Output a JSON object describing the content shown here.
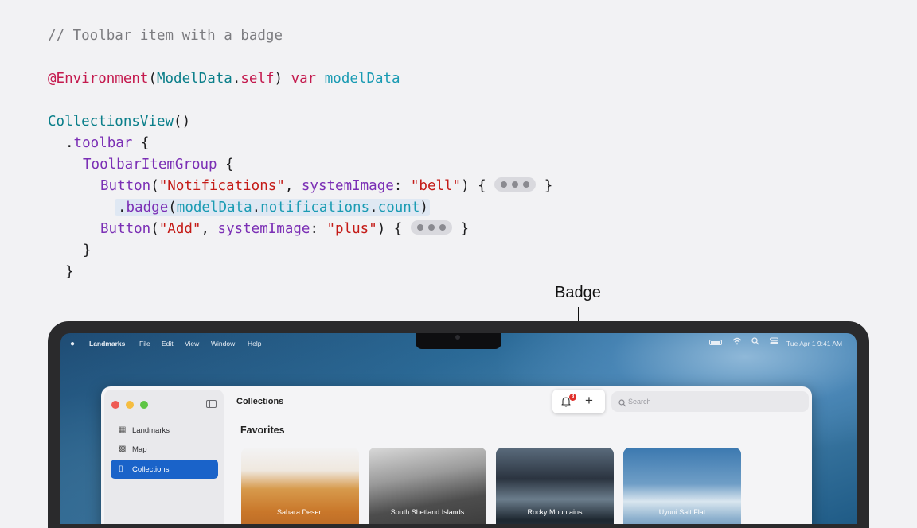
{
  "code": {
    "comment": "// Toolbar item with a badge",
    "env_at": "@Environment",
    "env_paren_open": "(",
    "env_type": "ModelData",
    "env_dot": ".",
    "env_self": "self",
    "env_paren_close": ")",
    "env_var": "var",
    "env_name": "modelData",
    "collections": "CollectionsView",
    "collections_parens": "()",
    "toolbar_dot": ".",
    "toolbar": "toolbar",
    "brace_open": " {",
    "group": "ToolbarItemGroup",
    "button": "Button",
    "paren_open": "(",
    "notif_str": "\"Notifications\"",
    "comma": ", ",
    "system_image": "systemImage",
    "colon": ": ",
    "bell_str": "\"bell\"",
    "close_brace_open": ") {",
    "close_brace": "}",
    "badge_dot": ".",
    "badge": "badge",
    "model_data": "modelData",
    "dot": ".",
    "notifications": "notifications",
    "count": "count",
    "close_paren": ")",
    "add_str": "\"Add\"",
    "plus_str": "\"plus\""
  },
  "callout": {
    "label": "Badge"
  },
  "menubar": {
    "app": "Landmarks",
    "items": [
      "File",
      "Edit",
      "View",
      "Window",
      "Help"
    ],
    "clock": "Tue Apr 1  9:41 AM"
  },
  "window": {
    "title": "Collections",
    "sidebar": [
      {
        "icon": "building-columns-icon",
        "label": "Landmarks",
        "selected": false
      },
      {
        "icon": "map-icon",
        "label": "Map",
        "selected": false
      },
      {
        "icon": "book-icon",
        "label": "Collections",
        "selected": true
      }
    ],
    "toolbar": {
      "badge_count": "8"
    },
    "search_placeholder": "Search",
    "section_title": "Favorites",
    "cards": [
      "Sahara Desert",
      "South Shetland Islands",
      "Rocky Mountains",
      "Uyuni Salt Flat"
    ]
  },
  "colors": {
    "accent": "#1a63c9",
    "badge": "#e0302b",
    "keyword": "#c41a4e",
    "type": "#0b7f8a",
    "function": "#7b2fb5",
    "string": "#c41a16"
  }
}
